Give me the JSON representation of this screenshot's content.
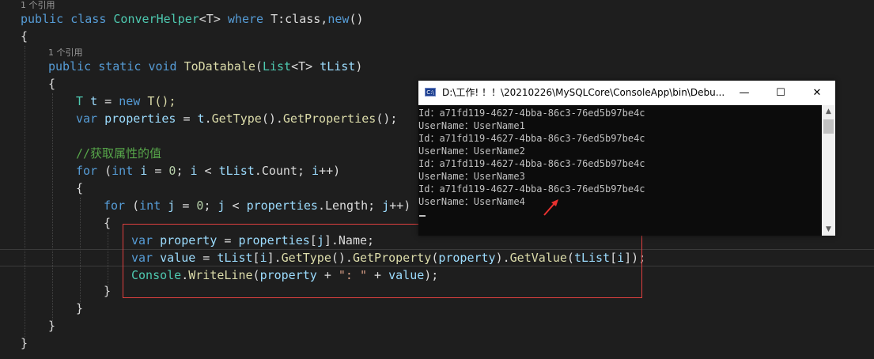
{
  "editor": {
    "codelens_class": "1 个引用",
    "codelens_method": "1 个引用",
    "lines": {
      "class_decl": {
        "kw_public": "public",
        "kw_class": "class",
        "class_name": "ConverHelper",
        "type_param": "<T>",
        "kw_where": "where",
        "constraint": "T:class,",
        "kw_new": "new",
        "parens": "()"
      },
      "open_brace_1": "{",
      "method_decl": {
        "kw_public": "public",
        "kw_static": "static",
        "kw_void": "void",
        "method_name": "ToDatabale",
        "lparen": "(",
        "list_type": "List",
        "list_tparam": "<T>",
        "param_name": "tList",
        "rparen": ")"
      },
      "open_brace_2": "{",
      "new_t": {
        "type": "T",
        "var": "t",
        "assign": " = ",
        "kw_new": "new",
        "call": "T();"
      },
      "props": {
        "kw_var": "var",
        "var": "properties",
        "assign": " = ",
        "obj": "t",
        "dot1": ".",
        "get_type": "GetType",
        "paren1": "().",
        "get_props": "GetProperties",
        "tail": "();"
      },
      "comment": "//获取属性的值",
      "for_i": {
        "kw_for": "for",
        "open": " (",
        "kw_int": "int",
        "var": "i",
        "init": " = ",
        "zero": "0",
        "semi1": "; ",
        "var2": "i",
        "lt": " < ",
        "list": "tList",
        "dot": ".",
        "count": "Count",
        "semi2": "; ",
        "var3": "i",
        "inc": "++)"
      },
      "brace_for_i_open": "{",
      "for_j": {
        "kw_for": "for",
        "open": " (",
        "kw_int": "int",
        "var": "j",
        "init": " = ",
        "zero": "0",
        "semi1": "; ",
        "var2": "j",
        "lt": " < ",
        "props": "properties",
        "dot": ".",
        "length": "Length",
        "semi2": "; ",
        "var3": "j",
        "inc": "++)"
      },
      "brace_for_j_open": "{",
      "property_line": {
        "kw_var": "var",
        "var": "property",
        "assign": " = ",
        "props": "properties",
        "idx_open": "[",
        "idx": "j",
        "idx_close": "].",
        "name": "Name",
        "semi": ";"
      },
      "value_line": {
        "kw_var": "var",
        "var": "value",
        "assign": " = ",
        "list": "tList",
        "idx_open": "[",
        "idx": "i",
        "idx_close": "].",
        "get_type": "GetType",
        "p1": "().",
        "get_property": "GetProperty",
        "p2": "(",
        "arg": "property",
        "p3": ").",
        "get_value": "GetValue",
        "p4": "(",
        "list2": "tList",
        "p5": "[",
        "idx2": "i",
        "p6": "]);"
      },
      "console_line": {
        "console": "Console",
        "dot": ".",
        "write_line": "WriteLine",
        "p1": "(",
        "arg": "property",
        "plus1": " + ",
        "str": "\": \"",
        "plus2": " + ",
        "val": "value",
        "p2": ");"
      },
      "brace_for_j_close": "}",
      "brace_for_i_close": "}",
      "brace_method_close": "}",
      "brace_class_close": "}"
    }
  },
  "console_window": {
    "title": "D:\\工作! ！！\\20210226\\MySQLCore\\ConsoleApp\\bin\\Debu...",
    "icon_label": "C:\\",
    "minimize": "—",
    "maximize": "☐",
    "close": "✕",
    "output": [
      "Id：a71fd119-4627-4bba-86c3-76ed5b97be4c",
      "UserName：UserName1",
      "Id：a71fd119-4627-4bba-86c3-76ed5b97be4c",
      "UserName：UserName2",
      "Id：a71fd119-4627-4bba-86c3-76ed5b97be4c",
      "UserName：UserName3",
      "Id：a71fd119-4627-4bba-86c3-76ed5b97be4c",
      "UserName：UserName4"
    ],
    "scroll_up": "▲",
    "scroll_down": "▼"
  },
  "colors": {
    "keyword": "#569cd6",
    "type": "#4ec9b0",
    "method": "#dcdcaa",
    "identifier": "#9cdcfe",
    "string": "#d69d85",
    "number": "#b5cea8",
    "comment": "#57a64a",
    "highlight_box": "#e0403f",
    "annotation_arrow": "#e8312f"
  }
}
